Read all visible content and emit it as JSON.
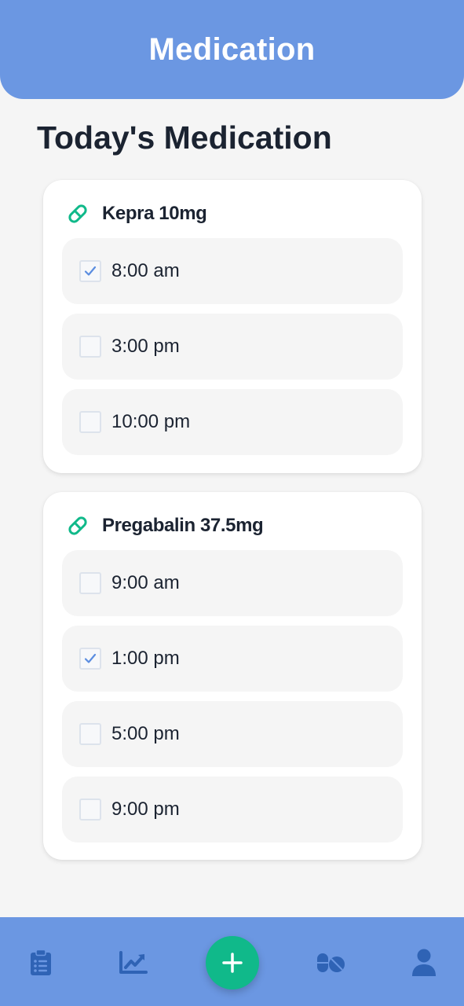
{
  "header": {
    "title": "Medication"
  },
  "page": {
    "title": "Today's Medication"
  },
  "medications": [
    {
      "name": "Kepra 10mg",
      "doses": [
        {
          "time": "8:00 am",
          "taken": true
        },
        {
          "time": "3:00 pm",
          "taken": false
        },
        {
          "time": "10:00 pm",
          "taken": false
        }
      ]
    },
    {
      "name": "Pregabalin 37.5mg",
      "doses": [
        {
          "time": "9:00 am",
          "taken": false
        },
        {
          "time": "1:00 pm",
          "taken": true
        },
        {
          "time": "5:00 pm",
          "taken": false
        },
        {
          "time": "9:00 pm",
          "taken": false
        }
      ]
    }
  ],
  "nav": {
    "items": [
      "clipboard-list-icon",
      "chart-line-icon",
      "plus-icon",
      "pills-icon",
      "user-icon"
    ]
  },
  "colors": {
    "primary": "#6b97e2",
    "accent": "#10b98a",
    "nav_icon": "#2f63b5",
    "check": "#5b8de0"
  }
}
